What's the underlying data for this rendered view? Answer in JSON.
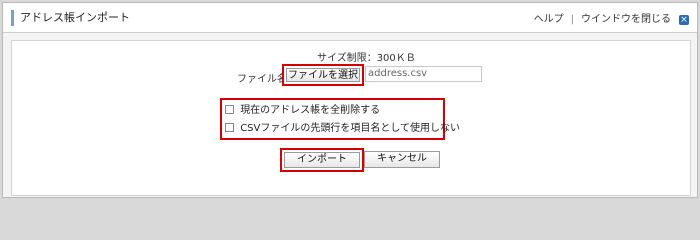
{
  "window": {
    "title": "アドレス帳インポート",
    "help_label": "ヘルプ",
    "separator": "|",
    "close_label": "ウインドウを閉じる",
    "close_icon_glyph": "×"
  },
  "form": {
    "size_limit": "サイズ制限：300ＫＢ",
    "file_label": "ファイル名",
    "file_button_label": "ファイルを選択",
    "file_name": "address.csv",
    "options": [
      {
        "label": "現在のアドレス帳を全削除する",
        "checked": false
      },
      {
        "label": "CSVファイルの先頭行を項目名として使用しない",
        "checked": false
      }
    ],
    "import_label": "インポート",
    "cancel_label": "キャンセル"
  }
}
